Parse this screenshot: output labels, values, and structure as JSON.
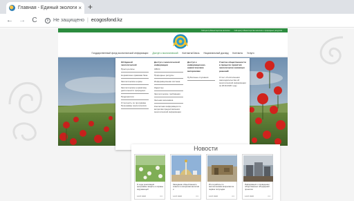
{
  "browser": {
    "tab_title": "Главная - Единый экологиче...",
    "tab_close": "×",
    "new_tab": "+",
    "back": "←",
    "forward": "→",
    "reload": "C",
    "info_glyph": "i",
    "security_text": "Не защищено",
    "url_separator": "|",
    "url": "ecogosfond.kz",
    "icons": [
      "back-arrow-icon",
      "forward-arrow-icon",
      "reload-icon",
      "info-icon",
      "close-icon",
      "plus-icon"
    ]
  },
  "site": {
    "colors": {
      "accent_green": "#2c8c3f",
      "flower_red": "#c8201c"
    },
    "top_links": [
      "Call-центр Министерства экологии",
      "Call-центр Министерства экологии и природных ресурсов"
    ],
    "nav": [
      {
        "label": "Государственный фонд экологической информации",
        "active": false
      },
      {
        "label": "Доступ к экологической",
        "active": true
      },
      {
        "label": "Контакты/Связь",
        "active": false
      },
      {
        "label": "Национальный доклад",
        "active": false
      },
      {
        "label": "Контакты",
        "active": false
      },
      {
        "label": "Услуги",
        "active": false
      }
    ],
    "mega_menu": {
      "col1": {
        "head": "Об Единой экологической",
        "items": [
          "Пресс-релизы",
          "Нормативно-правовая база",
          "Экологические нормы",
          "Экологические нормативы деятельности природных",
          "Предприятия",
          "Отчетность по программе Программы экологических"
        ]
      },
      "col2": {
        "head": "Доступ к экологической информации",
        "items": [
          "ОВОС",
          "Природные ресурсы",
          "Информационная система",
          "Кадастры",
          "Экологические требования",
          "Зеленая экономика",
          "Контактная информация по вопросам предоставления экологической информации"
        ]
      },
      "col3": {
        "head": "Доступ к информационно-аналитическим материалам",
        "items": [
          "Публичные слушания"
        ]
      },
      "col4": {
        "head": "Участие общественности в процессе принятия экологически значимых решений",
        "items": [
          "Отчет об исполнении законодательства об экологической информации за 2019-2020 годы"
        ]
      }
    },
    "news": {
      "title": "Новости",
      "cards": [
        {
          "text": "О ходе реализации программы защиты и охраны окружающей",
          "date": "14.07.2020",
          "meta": "0  0"
        },
        {
          "text": "Заседание общественного совета по вопросам экологии и",
          "date": "14.07.2020",
          "meta": "0  0"
        },
        {
          "text": "Итоги работы по экологическим вопросам за первое полугодие",
          "date": "14.07.2020",
          "meta": "0  0"
        },
        {
          "text": "Информация о проведении общественных обсуждений проектов",
          "date": "14.07.2020",
          "meta": "0  0"
        }
      ]
    }
  }
}
